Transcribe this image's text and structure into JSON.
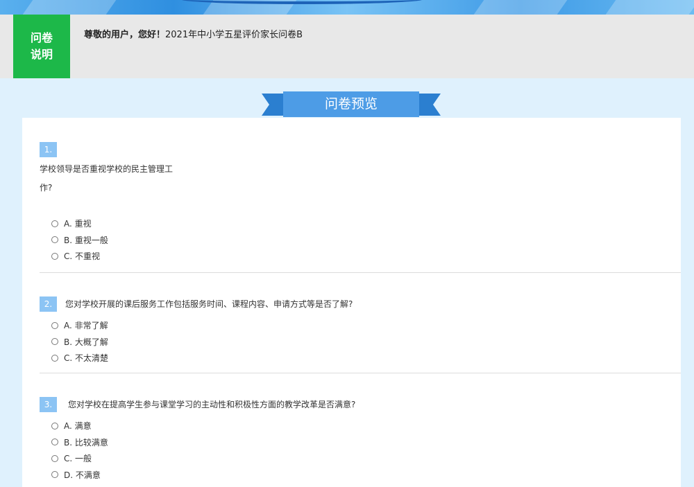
{
  "intro": {
    "tag_line1": "问卷",
    "tag_line2": "说明",
    "greeting": "尊敬的用户，您好！",
    "title": "2021年中小学五星评价家长问卷B"
  },
  "ribbon": {
    "label": "问卷预览"
  },
  "questions": [
    {
      "number": "1.",
      "text_line1": "学校领导是否重视学校的民主管理工",
      "text_line2": "作?",
      "options": [
        "A. 重视",
        "B. 重视一般",
        "C. 不重视"
      ]
    },
    {
      "number": "2.",
      "text": "您对学校开展的课后服务工作包括服务时间、课程内容、申请方式等是否了解?",
      "options": [
        "A. 非常了解",
        "B. 大概了解",
        "C. 不太清楚"
      ]
    },
    {
      "number": "3.",
      "text": "您对学校在提高学生参与课堂学习的主动性和积极性方面的教学改革是否满意?",
      "options": [
        "A. 满意",
        "B. 比较满意",
        "C. 一般",
        "D. 不满意"
      ]
    }
  ],
  "colors": {
    "page_bg": "#dff1fd",
    "tag_green": "#1db849",
    "ribbon_blue": "#4d9ce6",
    "number_badge": "#8cc4f4"
  }
}
